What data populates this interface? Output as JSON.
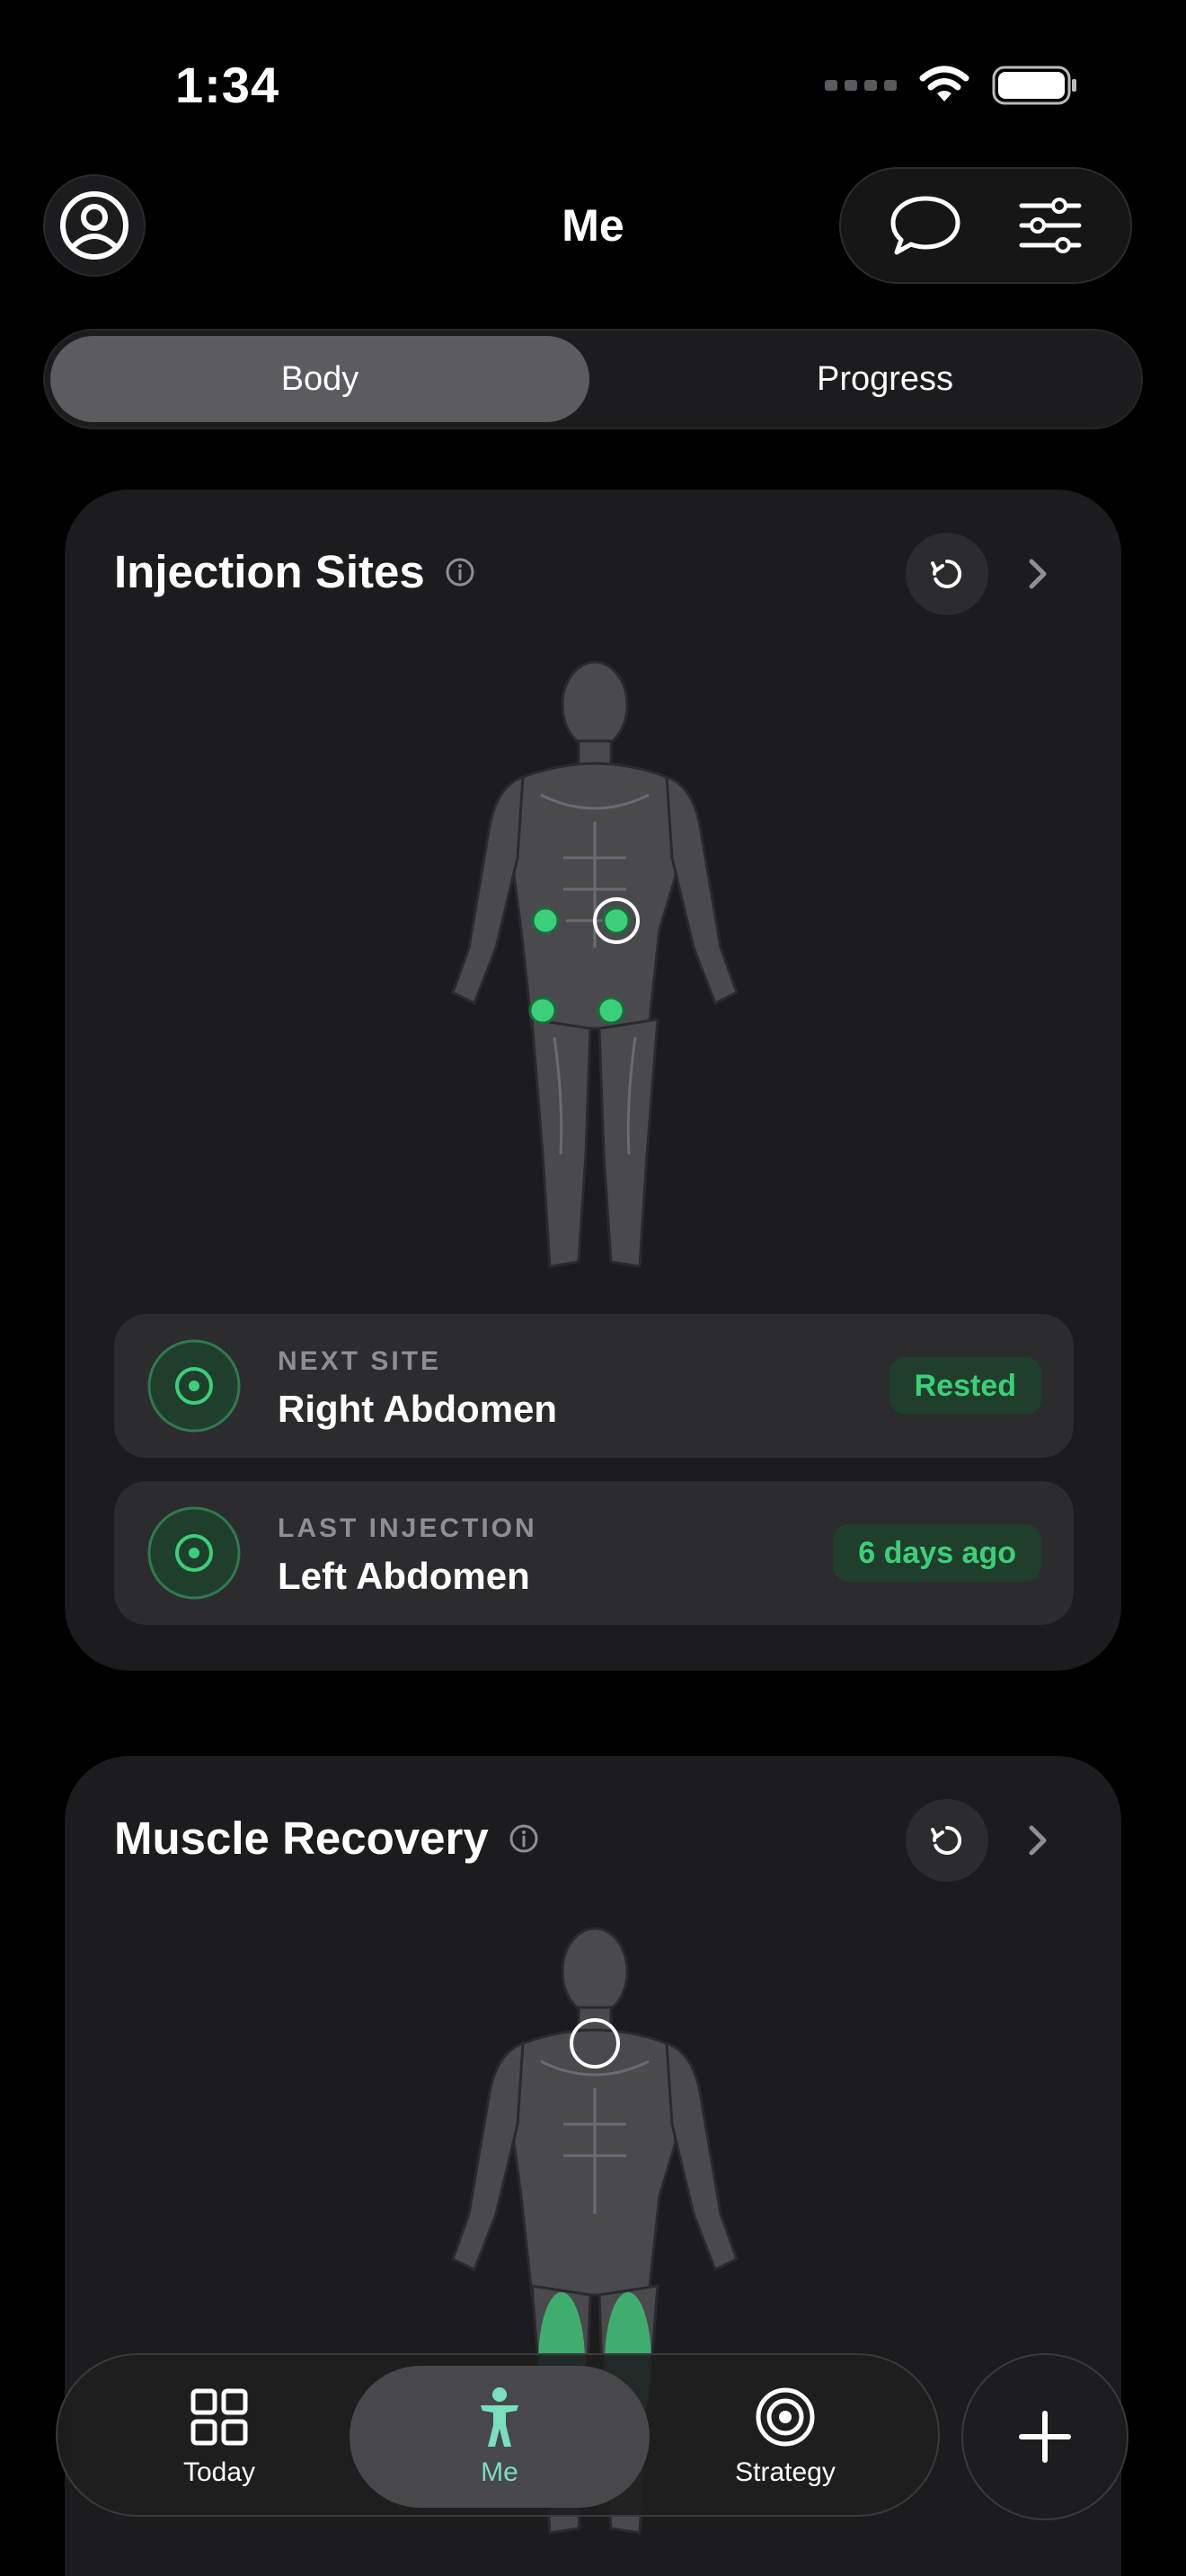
{
  "status_bar": {
    "time": "1:34"
  },
  "header": {
    "title": "Me",
    "profile_icon": "person-circle-icon",
    "chat_icon": "chat-bubble-icon",
    "settings_icon": "sliders-icon"
  },
  "segmented": {
    "tabs": [
      {
        "label": "Body",
        "selected": true
      },
      {
        "label": "Progress",
        "selected": false
      }
    ]
  },
  "injection_card": {
    "title": "Injection Sites",
    "next_site": {
      "label": "NEXT SITE",
      "value": "Right Abdomen",
      "badge": "Rested"
    },
    "last_injection": {
      "label": "LAST INJECTION",
      "value": "Left Abdomen",
      "badge": "6 days ago"
    }
  },
  "muscle_card": {
    "title": "Muscle Recovery"
  },
  "tabbar": {
    "items": [
      {
        "label": "Today",
        "icon": "grid-icon",
        "active": false
      },
      {
        "label": "Me",
        "icon": "person-icon",
        "active": true
      },
      {
        "label": "Strategy",
        "icon": "target-icon",
        "active": false
      }
    ],
    "plus_icon": "plus-icon"
  },
  "colors": {
    "accent_green": "#3ccf79",
    "accent_teal": "#79e0bd",
    "card_bg": "#1c1c1e"
  }
}
